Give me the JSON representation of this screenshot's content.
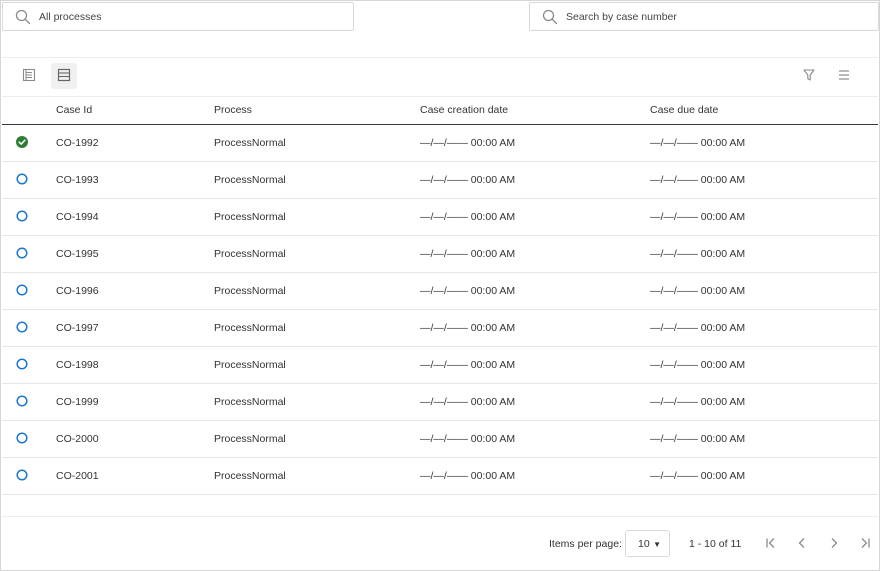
{
  "filters": {
    "process_filter": {
      "label": "All processes",
      "icon": "search-icon"
    },
    "case_search": {
      "placeholder": "Search by case number",
      "value": "",
      "icon": "search-icon"
    }
  },
  "toolbar": {
    "view_list_icon": "list-view-icon",
    "view_table_icon": "table-view-icon",
    "filter_icon": "filter-icon",
    "menu_icon": "menu-icon"
  },
  "table": {
    "headers": {
      "case_id": "Case Id",
      "process": "Process",
      "creation": "Case creation date",
      "due": "Case due date"
    },
    "rows": [
      {
        "status": "completed",
        "case_id": "CO-1992",
        "process": "ProcessNormal",
        "creation": "—/—/—— 00:00 AM",
        "due": "—/—/—— 00:00 AM"
      },
      {
        "status": "open",
        "case_id": "CO-1993",
        "process": "ProcessNormal",
        "creation": "—/—/—— 00:00 AM",
        "due": "—/—/—— 00:00 AM"
      },
      {
        "status": "open",
        "case_id": "CO-1994",
        "process": "ProcessNormal",
        "creation": "—/—/—— 00:00 AM",
        "due": "—/—/—— 00:00 AM"
      },
      {
        "status": "open",
        "case_id": "CO-1995",
        "process": "ProcessNormal",
        "creation": "—/—/—— 00:00 AM",
        "due": "—/—/—— 00:00 AM"
      },
      {
        "status": "open",
        "case_id": "CO-1996",
        "process": "ProcessNormal",
        "creation": "—/—/—— 00:00 AM",
        "due": "—/—/—— 00:00 AM"
      },
      {
        "status": "open",
        "case_id": "CO-1997",
        "process": "ProcessNormal",
        "creation": "—/—/—— 00:00 AM",
        "due": "—/—/—— 00:00 AM"
      },
      {
        "status": "open",
        "case_id": "CO-1998",
        "process": "ProcessNormal",
        "creation": "—/—/—— 00:00 AM",
        "due": "—/—/—— 00:00 AM"
      },
      {
        "status": "open",
        "case_id": "CO-1999",
        "process": "ProcessNormal",
        "creation": "—/—/—— 00:00 AM",
        "due": "—/—/—— 00:00 AM"
      },
      {
        "status": "open",
        "case_id": "CO-2000",
        "process": "ProcessNormal",
        "creation": "—/—/—— 00:00 AM",
        "due": "—/—/—— 00:00 AM"
      },
      {
        "status": "open",
        "case_id": "CO-2001",
        "process": "ProcessNormal",
        "creation": "—/—/—— 00:00 AM",
        "due": "—/—/—— 00:00 AM"
      }
    ]
  },
  "pagination": {
    "items_per_page_label": "Items per page:",
    "items_per_page_value": "10",
    "range_label": "1 - 10 of 11",
    "first_icon": "first-page-icon",
    "prev_icon": "previous-page-icon",
    "next_icon": "next-page-icon",
    "last_icon": "last-page-icon"
  },
  "colors": {
    "completed": "#2e7d32",
    "open": "#1976d2",
    "header_rule": "#3a3a3a",
    "icon_gray": "#888888"
  }
}
